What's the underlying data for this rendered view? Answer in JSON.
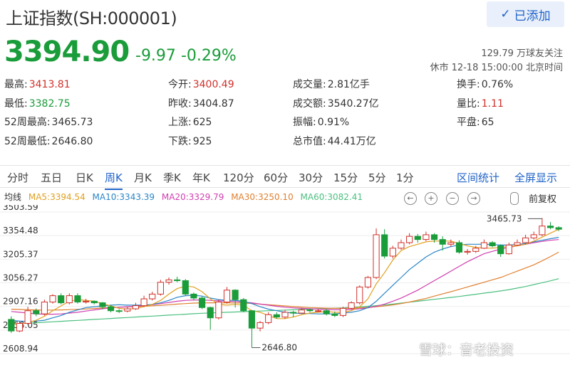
{
  "header": {
    "title": "上证指数(SH:000001)",
    "follow_button": "已添加",
    "price": "3394.90",
    "change": "-9.97",
    "change_pct": "-0.29%",
    "followers": "129.79 万球友关注",
    "status_time": "休市 12-18 15:00:00 北京时间"
  },
  "stats": [
    {
      "label": "最高:",
      "value": "3413.81",
      "color": "red"
    },
    {
      "label": "今开:",
      "value": "3400.49",
      "color": "red"
    },
    {
      "label": "成交量:",
      "value": "2.81亿手",
      "color": "normal"
    },
    {
      "label": "换手:",
      "value": "0.76%",
      "color": "normal"
    },
    {
      "label": "最低:",
      "value": "3382.75",
      "color": "green"
    },
    {
      "label": "昨收:",
      "value": "3404.87",
      "color": "normal"
    },
    {
      "label": "成交额:",
      "value": "3540.27亿",
      "color": "normal"
    },
    {
      "label": "量比:",
      "value": "1.11",
      "color": "red"
    },
    {
      "label": "52周最高:",
      "value": "3465.73",
      "color": "normal"
    },
    {
      "label": "上涨:",
      "value": "625",
      "color": "normal"
    },
    {
      "label": "振幅:",
      "value": "0.91%",
      "color": "normal"
    },
    {
      "label": "平盘:",
      "value": "65",
      "color": "normal"
    },
    {
      "label": "52周最低:",
      "value": "2646.80",
      "color": "normal"
    },
    {
      "label": "下跌:",
      "value": "925",
      "color": "normal"
    },
    {
      "label": "总市值:",
      "value": "44.41万亿",
      "color": "normal"
    }
  ],
  "tabs": [
    "分时",
    "五日",
    "日K",
    "周K",
    "月K",
    "季K",
    "年K",
    "120分",
    "60分",
    "30分",
    "15分",
    "5分",
    "1分"
  ],
  "active_tab": "周K",
  "tab_links": [
    "区间统计",
    "全屏显示"
  ],
  "ma": {
    "label": "均线",
    "ma5": "MA5:3394.54",
    "ma10": "MA10:3343.39",
    "ma20": "MA20:3329.79",
    "ma30": "MA30:3250.10",
    "ma60": "MA60:3082.41"
  },
  "tools": [
    "←",
    "+",
    "−",
    "→"
  ],
  "adjust": "前复权",
  "colors": {
    "up": "#d0302a",
    "down": "#1a9c3a",
    "accent": "#2063c8",
    "ma5": "#e0a020",
    "ma10": "#2a86c8",
    "ma20": "#d040b0",
    "ma30": "#e08030",
    "ma60": "#4cc080"
  },
  "chart_data": {
    "type": "candlestick",
    "y_ticks": [
      "3503.59",
      "3354.48",
      "3205.37",
      "3056.27",
      "2907.16",
      "2758.05",
      "2608.94"
    ],
    "ylim": [
      2608.94,
      3503.59
    ],
    "annotations": {
      "high": "3465.73",
      "low": "2646.80"
    },
    "candles": [
      {
        "o": 2825,
        "c": 2752,
        "h": 2845,
        "l": 2740
      },
      {
        "o": 2752,
        "c": 2800,
        "h": 2815,
        "l": 2745
      },
      {
        "o": 2800,
        "c": 2880,
        "h": 2905,
        "l": 2790
      },
      {
        "o": 2880,
        "c": 2860,
        "h": 2895,
        "l": 2845
      },
      {
        "o": 2860,
        "c": 2935,
        "h": 2950,
        "l": 2850
      },
      {
        "o": 2935,
        "c": 2975,
        "h": 2985,
        "l": 2925
      },
      {
        "o": 2975,
        "c": 2930,
        "h": 2990,
        "l": 2920
      },
      {
        "o": 2930,
        "c": 2975,
        "h": 2990,
        "l": 2920
      },
      {
        "o": 2975,
        "c": 2935,
        "h": 2990,
        "l": 2925
      },
      {
        "o": 2935,
        "c": 2940,
        "h": 2955,
        "l": 2925
      },
      {
        "o": 2940,
        "c": 2930,
        "h": 2945,
        "l": 2920
      },
      {
        "o": 2930,
        "c": 2905,
        "h": 2935,
        "l": 2890
      },
      {
        "o": 2905,
        "c": 2880,
        "h": 2915,
        "l": 2870
      },
      {
        "o": 2880,
        "c": 2878,
        "h": 2890,
        "l": 2865
      },
      {
        "o": 2878,
        "c": 2892,
        "h": 2905,
        "l": 2870
      },
      {
        "o": 2892,
        "c": 2912,
        "h": 2930,
        "l": 2885
      },
      {
        "o": 2912,
        "c": 2955,
        "h": 2975,
        "l": 2905
      },
      {
        "o": 2955,
        "c": 2985,
        "h": 3000,
        "l": 2945
      },
      {
        "o": 2985,
        "c": 3060,
        "h": 3075,
        "l": 2975
      },
      {
        "o": 3060,
        "c": 3075,
        "h": 3090,
        "l": 3045
      },
      {
        "o": 3075,
        "c": 3070,
        "h": 3095,
        "l": 3060
      },
      {
        "o": 3070,
        "c": 2985,
        "h": 3080,
        "l": 2975
      },
      {
        "o": 2985,
        "c": 2960,
        "h": 2995,
        "l": 2945
      },
      {
        "o": 2960,
        "c": 2900,
        "h": 2970,
        "l": 2890
      },
      {
        "o": 2900,
        "c": 2835,
        "h": 2905,
        "l": 2760
      },
      {
        "o": 2835,
        "c": 2935,
        "h": 2950,
        "l": 2825
      },
      {
        "o": 2935,
        "c": 3010,
        "h": 3030,
        "l": 2925
      },
      {
        "o": 3010,
        "c": 2950,
        "h": 3015,
        "l": 2900
      },
      {
        "o": 2950,
        "c": 2880,
        "h": 2960,
        "l": 2870
      },
      {
        "o": 2880,
        "c": 2770,
        "h": 2885,
        "l": 2646.8
      },
      {
        "o": 2770,
        "c": 2805,
        "h": 2815,
        "l": 2750
      },
      {
        "o": 2805,
        "c": 2855,
        "h": 2870,
        "l": 2795
      },
      {
        "o": 2855,
        "c": 2840,
        "h": 2870,
        "l": 2830
      },
      {
        "o": 2840,
        "c": 2870,
        "h": 2885,
        "l": 2830
      },
      {
        "o": 2870,
        "c": 2865,
        "h": 2880,
        "l": 2840
      },
      {
        "o": 2865,
        "c": 2885,
        "h": 2895,
        "l": 2860
      },
      {
        "o": 2885,
        "c": 2880,
        "h": 2895,
        "l": 2870
      },
      {
        "o": 2880,
        "c": 2880,
        "h": 2890,
        "l": 2870
      },
      {
        "o": 2880,
        "c": 2860,
        "h": 2890,
        "l": 2850
      },
      {
        "o": 2860,
        "c": 2850,
        "h": 2875,
        "l": 2840
      },
      {
        "o": 2850,
        "c": 2895,
        "h": 2905,
        "l": 2840
      },
      {
        "o": 2895,
        "c": 2930,
        "h": 2940,
        "l": 2885
      },
      {
        "o": 2930,
        "c": 3030,
        "h": 3040,
        "l": 2920
      },
      {
        "o": 3030,
        "c": 3090,
        "h": 3100,
        "l": 3020
      },
      {
        "o": 3090,
        "c": 3360,
        "h": 3400,
        "l": 3080
      },
      {
        "o": 3360,
        "c": 3225,
        "h": 3395,
        "l": 3210
      },
      {
        "o": 3225,
        "c": 3275,
        "h": 3290,
        "l": 3210
      },
      {
        "o": 3275,
        "c": 3310,
        "h": 3330,
        "l": 3265
      },
      {
        "o": 3310,
        "c": 3350,
        "h": 3370,
        "l": 3300
      },
      {
        "o": 3350,
        "c": 3330,
        "h": 3365,
        "l": 3310
      },
      {
        "o": 3330,
        "c": 3360,
        "h": 3380,
        "l": 3320
      },
      {
        "o": 3360,
        "c": 3330,
        "h": 3370,
        "l": 3310
      },
      {
        "o": 3330,
        "c": 3300,
        "h": 3350,
        "l": 3260
      },
      {
        "o": 3300,
        "c": 3310,
        "h": 3330,
        "l": 3285
      },
      {
        "o": 3310,
        "c": 3250,
        "h": 3325,
        "l": 3240
      },
      {
        "o": 3250,
        "c": 3255,
        "h": 3270,
        "l": 3235
      },
      {
        "o": 3255,
        "c": 3275,
        "h": 3290,
        "l": 3245
      },
      {
        "o": 3275,
        "c": 3310,
        "h": 3330,
        "l": 3270
      },
      {
        "o": 3310,
        "c": 3290,
        "h": 3320,
        "l": 3280
      },
      {
        "o": 3290,
        "c": 3240,
        "h": 3300,
        "l": 3220
      },
      {
        "o": 3240,
        "c": 3295,
        "h": 3310,
        "l": 3235
      },
      {
        "o": 3295,
        "c": 3310,
        "h": 3330,
        "l": 3290
      },
      {
        "o": 3310,
        "c": 3340,
        "h": 3360,
        "l": 3300
      },
      {
        "o": 3340,
        "c": 3360,
        "h": 3380,
        "l": 3330
      },
      {
        "o": 3360,
        "c": 3415,
        "h": 3465.73,
        "l": 3350
      },
      {
        "o": 3415,
        "c": 3405,
        "h": 3440,
        "l": 3395
      },
      {
        "o": 3405,
        "c": 3395,
        "h": 3414,
        "l": 3383
      }
    ],
    "ma5": [
      2800,
      2795,
      2805,
      2820,
      2845,
      2880,
      2910,
      2940,
      2950,
      2945,
      2940,
      2925,
      2910,
      2895,
      2890,
      2895,
      2905,
      2920,
      2945,
      2985,
      3020,
      3035,
      3030,
      3000,
      2955,
      2920,
      2915,
      2920,
      2915,
      2880,
      2870,
      2850,
      2830,
      2830,
      2840,
      2855,
      2865,
      2870,
      2875,
      2870,
      2870,
      2880,
      2905,
      2955,
      3050,
      3120,
      3200,
      3260,
      3285,
      3300,
      3315,
      3320,
      3320,
      3320,
      3305,
      3290,
      3280,
      3275,
      3275,
      3280,
      3285,
      3290,
      3300,
      3320,
      3345,
      3370,
      3394.54
    ],
    "ma10": [
      2820,
      2815,
      2812,
      2815,
      2820,
      2835,
      2850,
      2870,
      2885,
      2900,
      2905,
      2910,
      2915,
      2918,
      2915,
      2915,
      2915,
      2920,
      2930,
      2945,
      2965,
      2975,
      2978,
      2972,
      2960,
      2950,
      2945,
      2945,
      2940,
      2925,
      2905,
      2890,
      2880,
      2870,
      2865,
      2862,
      2862,
      2860,
      2860,
      2860,
      2865,
      2870,
      2880,
      2900,
      2940,
      2990,
      3040,
      3090,
      3140,
      3180,
      3220,
      3250,
      3270,
      3285,
      3295,
      3300,
      3300,
      3300,
      3298,
      3295,
      3295,
      3298,
      3305,
      3315,
      3325,
      3335,
      3343.39
    ],
    "ma20": [
      2875,
      2870,
      2865,
      2860,
      2858,
      2858,
      2860,
      2865,
      2870,
      2878,
      2885,
      2892,
      2898,
      2902,
      2905,
      2908,
      2912,
      2918,
      2925,
      2932,
      2940,
      2945,
      2948,
      2948,
      2945,
      2942,
      2940,
      2938,
      2935,
      2930,
      2922,
      2915,
      2908,
      2902,
      2898,
      2895,
      2892,
      2890,
      2888,
      2886,
      2886,
      2888,
      2892,
      2898,
      2908,
      2922,
      2940,
      2960,
      2985,
      3010,
      3040,
      3070,
      3100,
      3130,
      3160,
      3190,
      3215,
      3240,
      3255,
      3270,
      3280,
      3290,
      3300,
      3310,
      3318,
      3325,
      3329.79
    ],
    "ma30": [
      2890,
      2888,
      2886,
      2885,
      2884,
      2884,
      2885,
      2887,
      2889,
      2891,
      2894,
      2897,
      2900,
      2902,
      2904,
      2906,
      2908,
      2911,
      2914,
      2918,
      2922,
      2925,
      2928,
      2930,
      2930,
      2930,
      2930,
      2929,
      2928,
      2926,
      2922,
      2918,
      2914,
      2910,
      2906,
      2903,
      2900,
      2898,
      2896,
      2895,
      2895,
      2896,
      2898,
      2901,
      2905,
      2910,
      2917,
      2925,
      2935,
      2946,
      2958,
      2972,
      2986,
      3000,
      3015,
      3030,
      3045,
      3060,
      3075,
      3090,
      3110,
      3130,
      3150,
      3170,
      3195,
      3222,
      3250.1
    ],
    "ma60": [
      2795,
      2798,
      2801,
      2804,
      2807,
      2810,
      2813,
      2816,
      2819,
      2822,
      2825,
      2828,
      2831,
      2834,
      2837,
      2840,
      2843,
      2846,
      2849,
      2852,
      2855,
      2858,
      2861,
      2864,
      2866,
      2868,
      2870,
      2872,
      2874,
      2876,
      2878,
      2880,
      2882,
      2884,
      2886,
      2888,
      2890,
      2892,
      2894,
      2896,
      2898,
      2901,
      2904,
      2908,
      2912,
      2917,
      2922,
      2928,
      2934,
      2940,
      2946,
      2952,
      2958,
      2964,
      2970,
      2977,
      2984,
      2991,
      2998,
      3005,
      3013,
      3023,
      3033,
      3045,
      3057,
      3069,
      3082.41
    ]
  },
  "watermark": "雪球：音老投资"
}
